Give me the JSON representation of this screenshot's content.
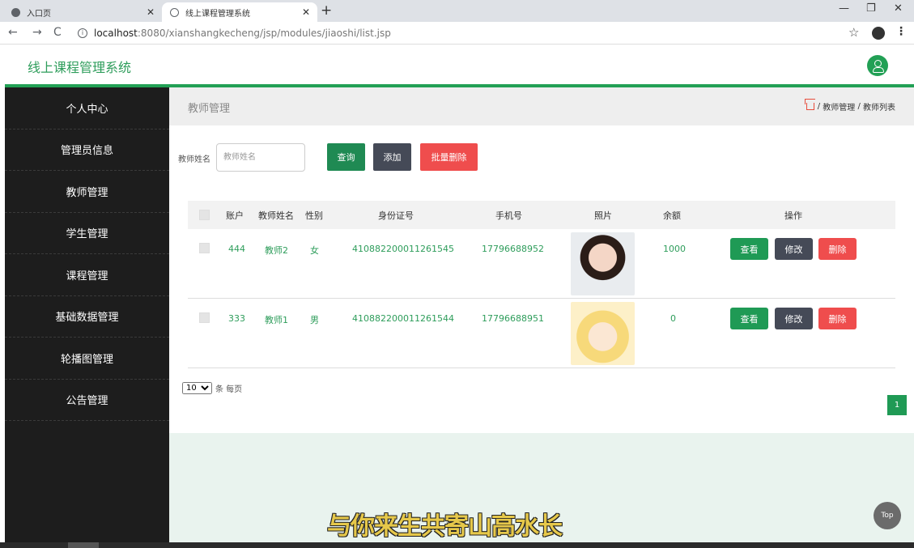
{
  "browser": {
    "tabs": [
      {
        "title": "入口页",
        "active": false
      },
      {
        "title": "线上课程管理系统",
        "active": true
      }
    ],
    "new_tab": "+",
    "url_host": "localhost",
    "url_path": ":8080/xianshangkecheng/jsp/modules/jiaoshi/list.jsp"
  },
  "app": {
    "title": "线上课程管理系统",
    "accent": "#22a055"
  },
  "sidebar": {
    "items": [
      "个人中心",
      "管理员信息",
      "教师管理",
      "学生管理",
      "课程管理",
      "基础数据管理",
      "轮播图管理",
      "公告管理"
    ]
  },
  "page": {
    "title": "教师管理",
    "breadcrumb": {
      "sep": "/",
      "level1": "教师管理",
      "level2": "教师列表"
    }
  },
  "search": {
    "label": "教师姓名",
    "placeholder": "教师姓名",
    "query_btn": "查询",
    "add_btn": "添加",
    "batch_delete_btn": "批量删除"
  },
  "table": {
    "columns": [
      "账户",
      "教师姓名",
      "性别",
      "身份证号",
      "手机号",
      "照片",
      "余额",
      "操作"
    ],
    "rows": [
      {
        "account": "444",
        "name": "教师2",
        "gender": "女",
        "id_card": "410882200011261545",
        "phone": "17796688952",
        "balance": "1000"
      },
      {
        "account": "333",
        "name": "教师1",
        "gender": "男",
        "id_card": "410882200011261544",
        "phone": "17796688951",
        "balance": "0"
      }
    ],
    "actions": {
      "view": "查看",
      "edit": "修改",
      "delete": "删除"
    }
  },
  "pagination": {
    "page_size": "10",
    "page_size_label": "条 每页",
    "current_page": "1"
  },
  "footer": {
    "subtitle": "与你来生共寄山高水长",
    "top_btn": "Top"
  }
}
